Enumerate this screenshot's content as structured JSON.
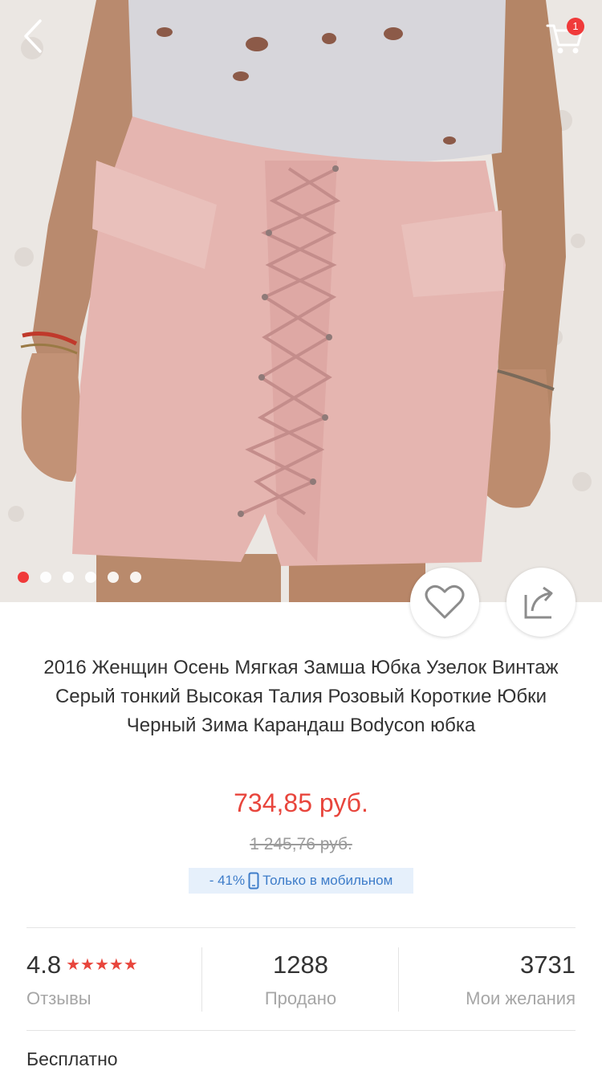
{
  "header": {
    "back_icon": "chevron-left-icon",
    "cart_icon": "cart-icon",
    "cart_count": "1"
  },
  "gallery": {
    "total_images": 6,
    "active_index": 0
  },
  "actions": {
    "favorite_icon": "heart-icon",
    "share_icon": "share-icon"
  },
  "product": {
    "title": "2016 Женщин Осень Мягкая Замша Юбка Узелок Винтаж Серый тонкий Высокая Талия Розовый Короткие Юбки Черный Зима Карандаш Bodycon юбка",
    "price": "734,85 руб.",
    "old_price": "1 245,76 руб.",
    "discount": "- 41%",
    "promo_text": "Только в мобильном",
    "promo_icon": "phone-icon"
  },
  "stats": {
    "rating": "4.8",
    "stars": "★★★★★",
    "reviews_label": "Отзывы",
    "sold": "1288",
    "sold_label": "Продано",
    "wishes": "3731",
    "wishes_label": "Мои желания"
  },
  "shipping": {
    "label": "Бесплатно"
  },
  "colors": {
    "accent": "#e8453c",
    "promo_bg": "#e6f0fb",
    "promo_text": "#3d7cc9"
  }
}
